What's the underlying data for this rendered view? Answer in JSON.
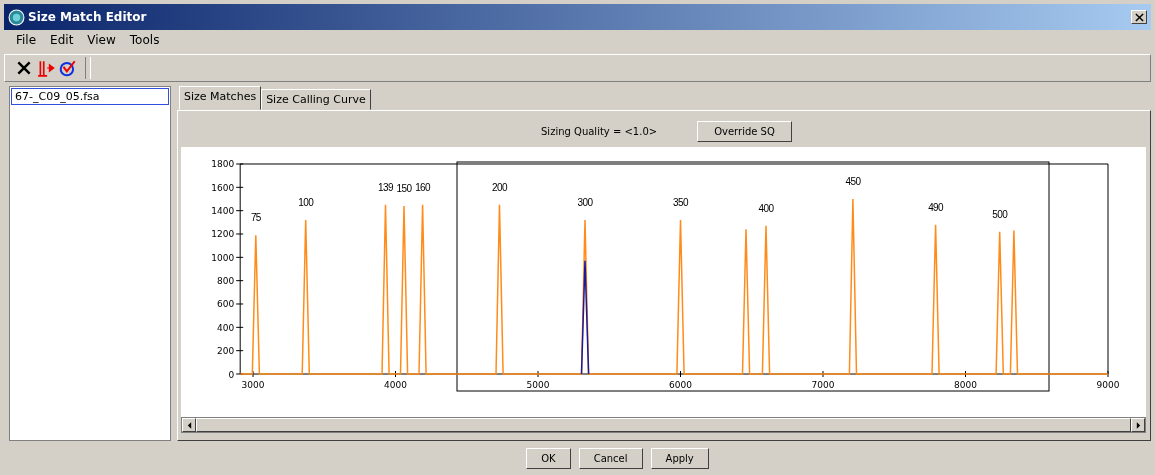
{
  "window": {
    "title": "Size Match Editor"
  },
  "menu": [
    "File",
    "Edit",
    "View",
    "Tools"
  ],
  "file_list": [
    {
      "label": "67-_C09_05.fsa",
      "selected": true
    }
  ],
  "tabs": [
    {
      "label": "Size Matches",
      "selected": true
    },
    {
      "label": "Size Calling Curve",
      "selected": false
    }
  ],
  "quality": {
    "text": "Sizing Quality = <1.0>",
    "button": "Override SQ"
  },
  "chart_data": {
    "type": "line",
    "xlim": [
      2910,
      9000
    ],
    "ylim": [
      0,
      1800
    ],
    "xticks": [
      3000,
      4000,
      5000,
      6000,
      7000,
      8000,
      9000
    ],
    "yticks": [
      0,
      200,
      400,
      600,
      800,
      1000,
      1200,
      1400,
      1600,
      1800
    ],
    "x": [
      2910,
      2995,
      3020,
      3045,
      3345,
      3370,
      3395,
      3905,
      3930,
      3955,
      4035,
      4060,
      4085,
      4165,
      4190,
      4215,
      4705,
      4730,
      4755,
      5305,
      5330,
      5355,
      5975,
      6000,
      6025,
      6435,
      6460,
      6485,
      6575,
      6600,
      6625,
      7185,
      7210,
      7235,
      7765,
      7790,
      7815,
      8215,
      8240,
      8265,
      8315,
      8340,
      8365,
      9000
    ],
    "series": [
      {
        "color": "#ff8c1a",
        "values": [
          0,
          0,
          1190,
          0,
          0,
          1320,
          0,
          0,
          1450,
          0,
          0,
          1440,
          0,
          0,
          1450,
          0,
          0,
          1450,
          0,
          0,
          1320,
          0,
          0,
          1320,
          0,
          0,
          1240,
          0,
          0,
          1270,
          0,
          0,
          1500,
          0,
          0,
          1280,
          0,
          0,
          1220,
          0,
          0,
          1230,
          0,
          0
        ]
      },
      {
        "color": "#1a1a9c",
        "values": [
          null,
          null,
          null,
          null,
          null,
          null,
          null,
          null,
          null,
          null,
          null,
          null,
          null,
          null,
          null,
          null,
          null,
          null,
          null,
          0,
          970,
          0,
          null,
          null,
          null,
          null,
          null,
          null,
          null,
          null,
          null,
          null,
          null,
          null,
          null,
          null,
          null,
          null,
          null,
          null,
          null,
          null,
          null,
          null
        ]
      }
    ],
    "annotations": [
      {
        "x": 3020,
        "y": 1190,
        "text": "75"
      },
      {
        "x": 3370,
        "y": 1320,
        "text": "100"
      },
      {
        "x": 3930,
        "y": 1450,
        "text": "139"
      },
      {
        "x": 4060,
        "y": 1440,
        "text": "150"
      },
      {
        "x": 4190,
        "y": 1450,
        "text": "160"
      },
      {
        "x": 4730,
        "y": 1450,
        "text": "200"
      },
      {
        "x": 5330,
        "y": 1320,
        "text": "300"
      },
      {
        "x": 6000,
        "y": 1320,
        "text": "350"
      },
      {
        "x": 6600,
        "y": 1270,
        "text": "400"
      },
      {
        "x": 7210,
        "y": 1500,
        "text": "450"
      },
      {
        "x": 7790,
        "y": 1280,
        "text": "490"
      },
      {
        "x": 8240,
        "y": 1220,
        "text": "500"
      }
    ]
  },
  "buttons": [
    "OK",
    "Cancel",
    "Apply"
  ]
}
